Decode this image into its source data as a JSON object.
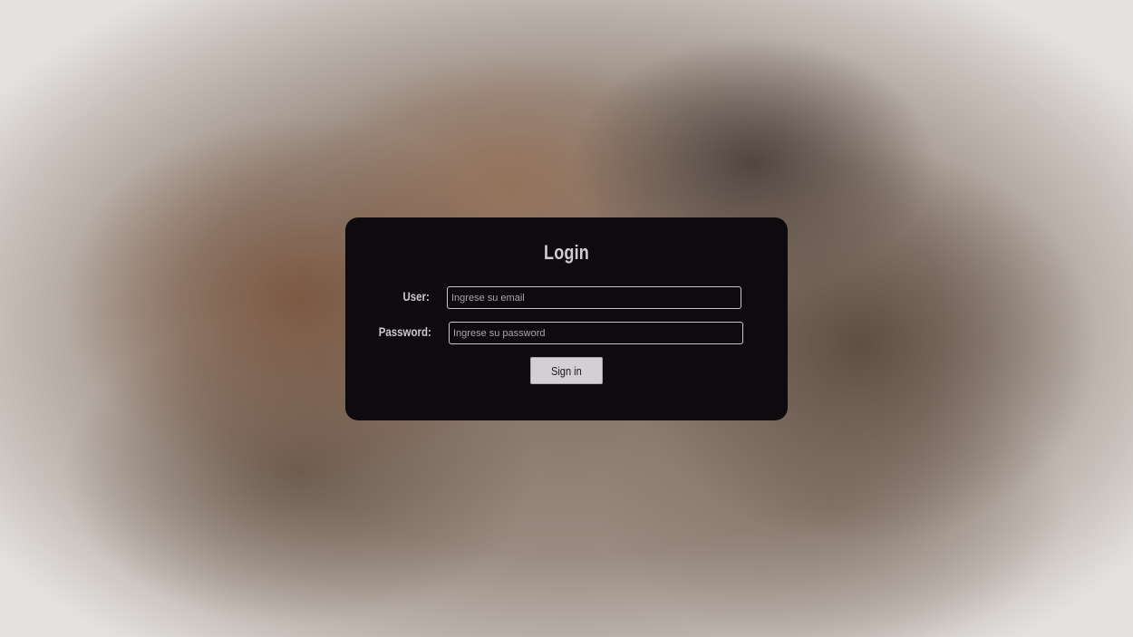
{
  "login": {
    "title": "Login",
    "user_label": "User:",
    "user_placeholder": "Ingrese su email",
    "password_label": "Password:",
    "password_placeholder": "Ingrese su password",
    "signin_label": "Sign in"
  },
  "colors": {
    "card_background": "#0d0b0d",
    "text": "#cfcdd2",
    "button_background": "#d3d0d4"
  }
}
